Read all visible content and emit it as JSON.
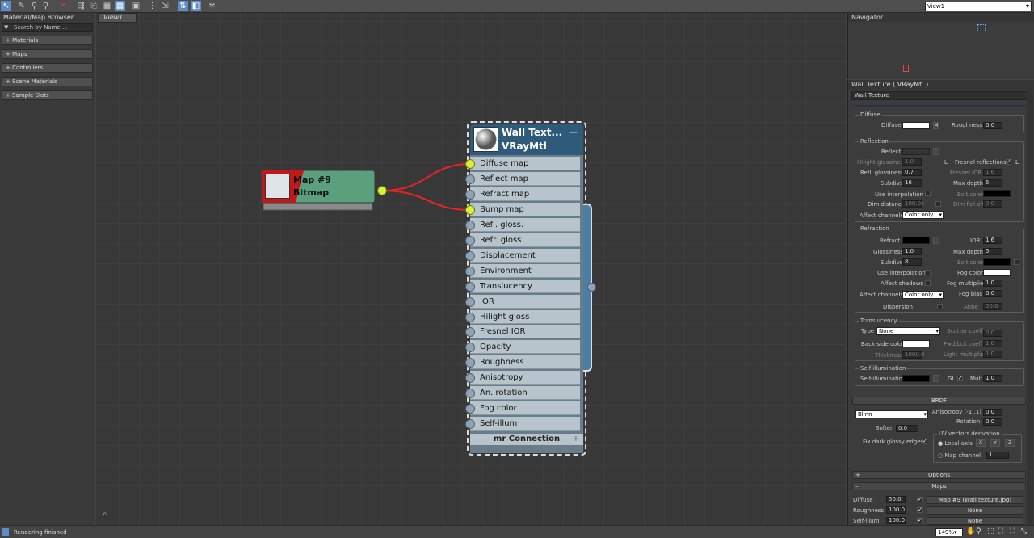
{
  "toolbar": {
    "view_selector": "View1"
  },
  "browser": {
    "title": "Material/Map Browser",
    "search_placeholder": "Search by Name ...",
    "sections": [
      "+ Materials",
      "+ Maps",
      "+ Controllers",
      "+ Scene Materials",
      "+ Sample Slots"
    ]
  },
  "viewport": {
    "tab": "View1"
  },
  "bitmap_node": {
    "title": "Map #9",
    "subtitle": "Bitmap"
  },
  "vray_node": {
    "title": "Wall Text...",
    "subtitle": "VRayMtl",
    "slots": [
      "Diffuse map",
      "Reflect map",
      "Refract map",
      "Bump map",
      "Refl. gloss.",
      "Refr. gloss.",
      "Displacement",
      "Environment",
      "Translucency",
      "IOR",
      "Hilight gloss",
      "Fresnel IOR",
      "Opacity",
      "Roughness",
      "Anisotropy",
      "An. rotation",
      "Fog color",
      "Self-illum"
    ],
    "connected": [
      0,
      3
    ],
    "footer": "mr Connection"
  },
  "navigator": {
    "title": "Navigator"
  },
  "params": {
    "header": "Wall Texture  ( VRayMtl )",
    "material_name": "Wall Texture",
    "diffuse": {
      "group": "Diffuse",
      "diffuse_label": "Diffuse",
      "m": "M",
      "roughness_label": "Roughness",
      "roughness": "0.0"
    },
    "reflection": {
      "group": "Reflection",
      "reflect": "Reflect",
      "hilight_gloss": "Hilight glossiness",
      "hilight_gloss_val": "1.0",
      "l": "L",
      "fresnel": "Fresnel reflections",
      "fresnel_l": "L",
      "refl_gloss": "Refl. glossiness",
      "refl_gloss_val": "0.7",
      "fresnel_ior": "Fresnel IOR",
      "fresnel_ior_val": "1.6",
      "subdivs": "Subdivs",
      "subdivs_val": "16",
      "max_depth": "Max depth",
      "max_depth_val": "5",
      "use_interp": "Use interpolation",
      "exit_color": "Exit color",
      "dim_distance": "Dim distance",
      "dim_distance_val": "100.0c",
      "dim_falloff": "Dim fall off",
      "dim_falloff_val": "0.0",
      "affect": "Affect channels",
      "affect_val": "Color only"
    },
    "refraction": {
      "group": "Refraction",
      "refract": "Refract",
      "ior": "IOR",
      "ior_val": "1.6",
      "gloss": "Glossiness",
      "gloss_val": "1.0",
      "max_depth": "Max depth",
      "max_depth_val": "5",
      "subdivs": "Subdivs",
      "subdivs_val": "8",
      "exit_color": "Exit color",
      "use_interp": "Use interpolation",
      "fog_color": "Fog color",
      "affect_shadows": "Affect shadows",
      "fog_mult": "Fog multiplier",
      "fog_mult_val": "1.0",
      "affect": "Affect channels",
      "affect_val": "Color only",
      "fog_bias": "Fog bias",
      "fog_bias_val": "0.0",
      "dispersion": "Dispersion",
      "abbe": "Abbe",
      "abbe_val": "50.0"
    },
    "translucency": {
      "group": "Translucency",
      "type": "Type",
      "type_val": "None",
      "scatter": "Scatter coeff",
      "scatter_val": "0.0",
      "backside": "Back-side color",
      "fwd": "Fwd/bck coeff",
      "fwd_val": "1.0",
      "thickness": "Thickness",
      "thickness_val": "1000.0",
      "light_mult": "Light multiplier",
      "light_mult_val": "1.0"
    },
    "selfillum": {
      "group": "Self-illumination",
      "label": "Self-illumination",
      "gi": "GI",
      "mult": "Mult",
      "mult_val": "1.0"
    },
    "brdf": {
      "title": "BRDF",
      "type_val": "Blinn",
      "aniso": "Anisotropy (-1..1)",
      "aniso_val": "0.0",
      "rotation": "Rotation",
      "rotation_val": "0.0",
      "soften": "Soften",
      "soften_val": "0.0",
      "uv_group": "UV vectors derivation",
      "fix_dark": "Fix dark glossy edges",
      "local_axis": "Local axis",
      "x": "X",
      "y": "Y",
      "z": "Z",
      "map_channel": "Map channel",
      "map_channel_val": "1"
    },
    "options": {
      "title": "Options"
    },
    "maps": {
      "title": "Maps",
      "rows": [
        {
          "label": "Diffuse",
          "amount": "50.0",
          "map": "Map #9 (Wall texture.jpg)"
        },
        {
          "label": "Roughness",
          "amount": "100.0",
          "map": "None"
        },
        {
          "label": "Self-illum",
          "amount": "100.0",
          "map": "None"
        }
      ]
    }
  },
  "status": {
    "text": "Rendering finished",
    "zoom": "149%"
  }
}
